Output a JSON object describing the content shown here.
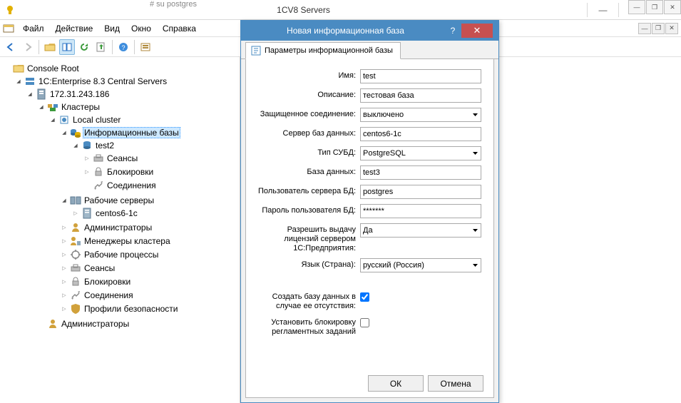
{
  "top_strip_text": "# su postgres",
  "window": {
    "title": "1CV8 Servers"
  },
  "menu": {
    "file": "Файл",
    "action": "Действие",
    "view": "Вид",
    "window": "Окно",
    "help": "Справка"
  },
  "tree": {
    "root": "Console Root",
    "central_servers": "1C:Enterprise 8.3 Central Servers",
    "server_ip": "172.31.243.186",
    "clusters": "Кластеры",
    "local_cluster": "Local cluster",
    "infobases": "Информационные базы",
    "ib_test2": "test2",
    "sessions": "Сеансы",
    "locks": "Блокировки",
    "connections": "Соединения",
    "work_servers": "Рабочие серверы",
    "ws_centos": "centos6-1c",
    "admins": "Администраторы",
    "mgr": "Менеджеры кластера",
    "work_procs": "Рабочие процессы",
    "sessions2": "Сеансы",
    "locks2": "Блокировки",
    "connections2": "Соединения",
    "sec_profiles": "Профили безопасности",
    "admins2": "Администраторы"
  },
  "dialog": {
    "title": "Новая информационная база",
    "tab": "Параметры информационной базы",
    "labels": {
      "name": "Имя:",
      "desc": "Описание:",
      "secure": "Защищенное соединение:",
      "dbserver": "Сервер баз данных:",
      "dbtype": "Тип СУБД:",
      "dbname": "База данных:",
      "dbuser": "Пользователь сервера БД:",
      "dbpass": "Пароль пользователя БД:",
      "license": "Разрешить выдачу лицензий сервером 1С:Предприятия:",
      "lang": "Язык (Страна):",
      "create_db": "Создать базу данных в случае ее отсутствия:",
      "lock_jobs": "Установить блокировку регламентных заданий"
    },
    "values": {
      "name": "test",
      "desc": "тестовая база",
      "secure": "выключено",
      "dbserver": "centos6-1c",
      "dbtype": "PostgreSQL",
      "dbname": "test3",
      "dbuser": "postgres",
      "dbpass": "*******",
      "license": "Да",
      "lang": "русский (Россия)"
    },
    "buttons": {
      "ok": "ОК",
      "cancel": "Отмена"
    }
  }
}
